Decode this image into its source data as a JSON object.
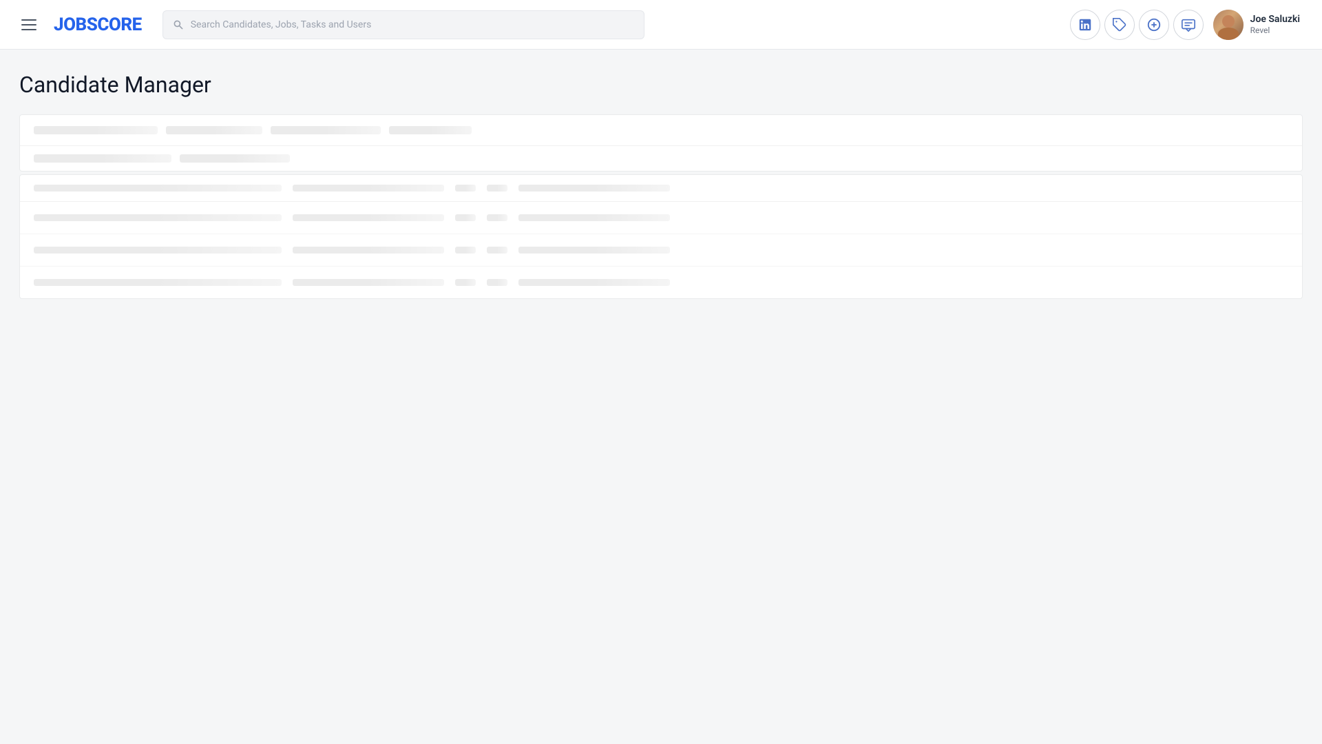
{
  "app": {
    "name": "JOBSCORE",
    "loading_bar_visible": true
  },
  "navbar": {
    "logo_part1": "JOB",
    "logo_part2": "SCORE",
    "search_placeholder": "Search Candidates, Jobs, Tasks and Users",
    "icons": [
      {
        "name": "linkedin-icon",
        "label": "LinkedIn"
      },
      {
        "name": "tag-icon",
        "label": "Tag"
      },
      {
        "name": "add-icon",
        "label": "Add"
      },
      {
        "name": "messages-icon",
        "label": "Messages"
      }
    ],
    "user": {
      "name": "Joe Saluzki",
      "company": "Revel"
    }
  },
  "page": {
    "title": "Candidate Manager"
  },
  "skeleton": {
    "filter_bar_lines": 4,
    "table_rows": 3
  }
}
